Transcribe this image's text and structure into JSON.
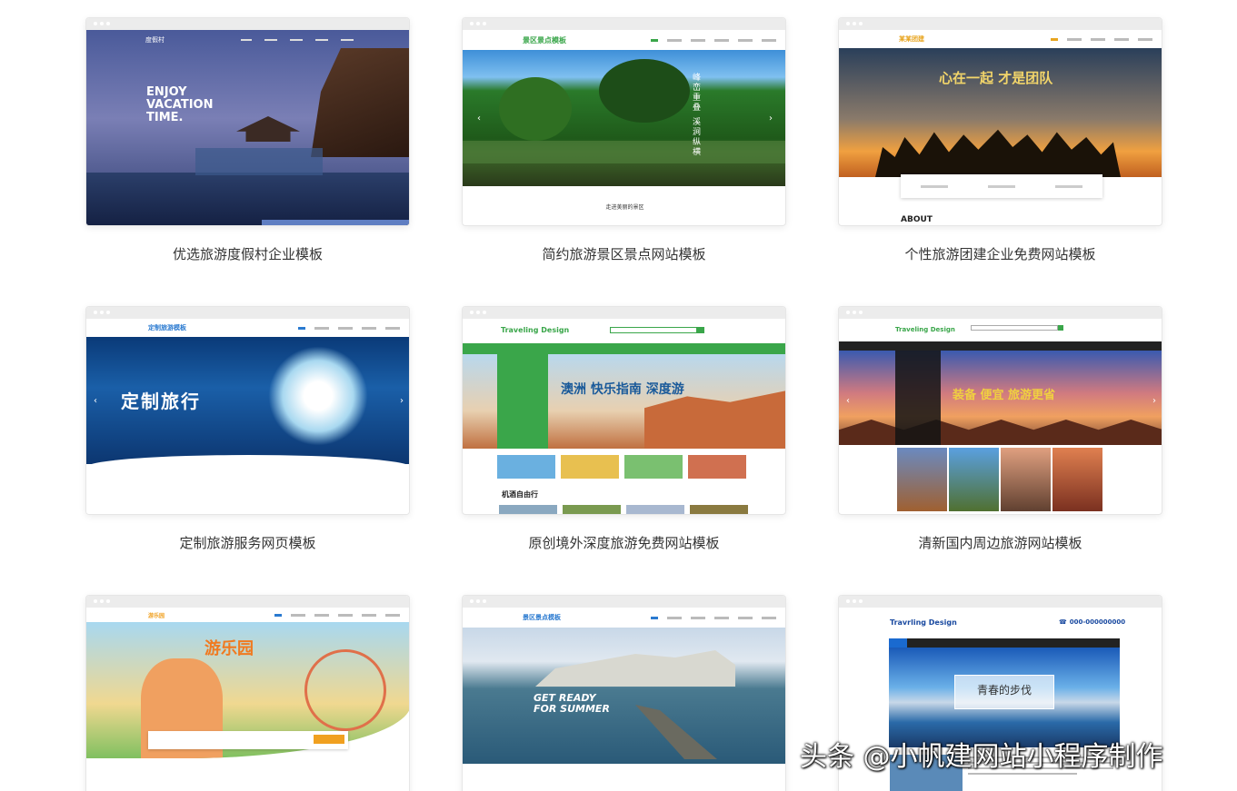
{
  "templates": [
    {
      "title": "优选旅游度假村企业模板",
      "logo": "度假村",
      "hero_text": "ENJOY VACATION TIME."
    },
    {
      "title": "简约旅游景区景点网站模板",
      "logo": "景区景点模板",
      "hero_text": "峰峦重叠 溪涧纵横",
      "subtitle": "走进美丽的景区"
    },
    {
      "title": "个性旅游团建企业免费网站模板",
      "logo": "某某团建",
      "hero_text": "心在一起 才是团队",
      "subtitle": "ABOUT"
    },
    {
      "title": "定制旅游服务网页模板",
      "logo": "定制旅游模板",
      "hero_text": "定制旅行"
    },
    {
      "title": "原创境外深度旅游免费网站模板",
      "logo": "Traveling Design",
      "hero_text": "澳洲 快乐指南 深度游",
      "subtitle": "机酒自由行"
    },
    {
      "title": "清新国内周边旅游网站模板",
      "logo": "Traveling Design",
      "hero_text": "装备 便宜 旅游更省"
    },
    {
      "title": "",
      "logo": "游乐园",
      "hero_text": "游乐园"
    },
    {
      "title": "",
      "logo": "景区景点模板",
      "hero_text": "GET READY FOR SUMMER"
    },
    {
      "title": "",
      "logo": "Travrling Design",
      "hero_text": "青春的步伐",
      "phone": "000-000000000"
    }
  ],
  "watermark": "头条 @小帆建网站小程序制作"
}
